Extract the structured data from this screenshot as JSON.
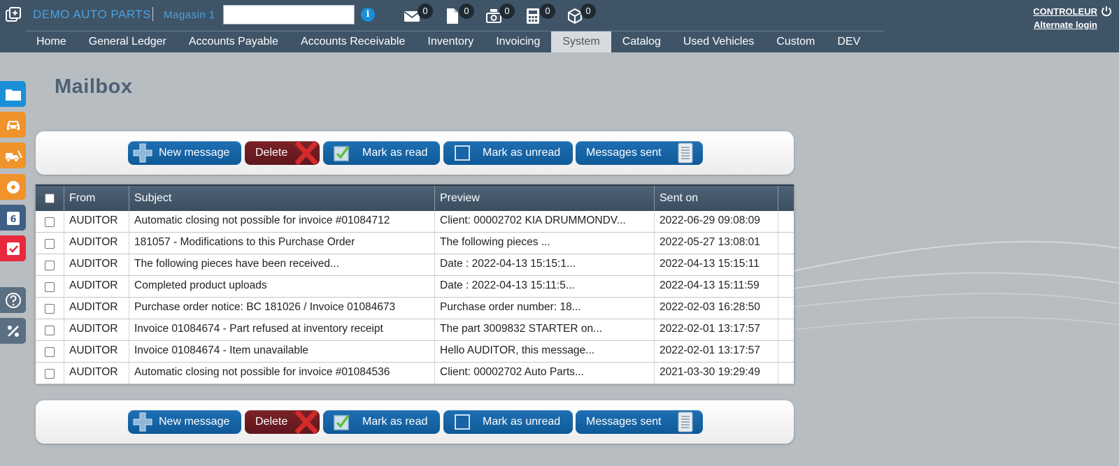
{
  "header": {
    "company": "DEMO AUTO PARTS",
    "store_label": "Magasin 1",
    "store_input_value": "",
    "user": "CONTROLEUR",
    "alternate_login": "Alternate login",
    "counters": [
      {
        "icon": "mail-icon",
        "count": "0"
      },
      {
        "icon": "document-icon",
        "count": "0"
      },
      {
        "icon": "cash-icon",
        "count": "0"
      },
      {
        "icon": "calculator-icon",
        "count": "0"
      },
      {
        "icon": "package-icon",
        "count": "0"
      }
    ]
  },
  "nav": {
    "items": [
      "Home",
      "General Ledger",
      "Accounts Payable",
      "Accounts Receivable",
      "Inventory",
      "Invoicing",
      "System",
      "Catalog",
      "Used Vehicles",
      "Custom",
      "DEV"
    ],
    "active": "System"
  },
  "rail": [
    {
      "icon": "folder-icon",
      "color": "#1a8fd6"
    },
    {
      "icon": "car-icon",
      "color": "#f0932b"
    },
    {
      "icon": "tow-truck-icon",
      "color": "#f0932b"
    },
    {
      "icon": "disc-icon",
      "color": "#f0932b"
    },
    {
      "icon": "calendar-icon",
      "color": "#3f5f86"
    },
    {
      "icon": "checkbox-icon",
      "color": "#e8283c"
    },
    {
      "icon": "help-icon",
      "color": "#5b6f82"
    },
    {
      "icon": "percent-icon",
      "color": "#5b6f82"
    }
  ],
  "page": {
    "title": "Mailbox"
  },
  "toolbar": {
    "new_message": "New message",
    "delete": "Delete",
    "mark_read": "Mark as read",
    "mark_unread": "Mark as unread",
    "messages_sent": "Messages sent"
  },
  "table": {
    "columns": [
      "From",
      "Subject",
      "Preview",
      "Sent on"
    ],
    "rows": [
      {
        "from": "AUDITOR",
        "subject": "Automatic closing not possible for invoice #01084712",
        "preview": "Client: 00002702 KIA DRUMMONDV...",
        "sent": "2022-06-29 09:08:09"
      },
      {
        "from": "AUDITOR",
        "subject": "181057 - Modifications to this Purchase Order",
        "preview": "The following pieces ...",
        "sent": "2022-05-27 13:08:01"
      },
      {
        "from": "AUDITOR",
        "subject": "The following pieces have been received...",
        "preview": "Date : 2022-04-13 15:15:1...",
        "sent": "2022-04-13 15:15:11"
      },
      {
        "from": "AUDITOR",
        "subject": "Completed product uploads",
        "preview": "Date : 2022-04-13 15:11:5...",
        "sent": "2022-04-13 15:11:59"
      },
      {
        "from": "AUDITOR",
        "subject": "Purchase order notice: BC 181026 / Invoice 01084673",
        "preview": "Purchase order number: 18...",
        "sent": "2022-02-03 16:28:50"
      },
      {
        "from": "AUDITOR",
        "subject": "Invoice 01084674 - Part refused at inventory receipt",
        "preview": "The part 3009832 STARTER on...",
        "sent": "2022-02-01 13:17:57"
      },
      {
        "from": "AUDITOR",
        "subject": "Invoice 01084674 - Item unavailable",
        "preview": "Hello AUDITOR, this message...",
        "sent": "2022-02-01 13:17:57"
      },
      {
        "from": "AUDITOR",
        "subject": "Automatic closing not possible for invoice #01084536",
        "preview": "Client: 00002702 Auto Parts...",
        "sent": "2021-03-30 19:29:49"
      }
    ]
  }
}
